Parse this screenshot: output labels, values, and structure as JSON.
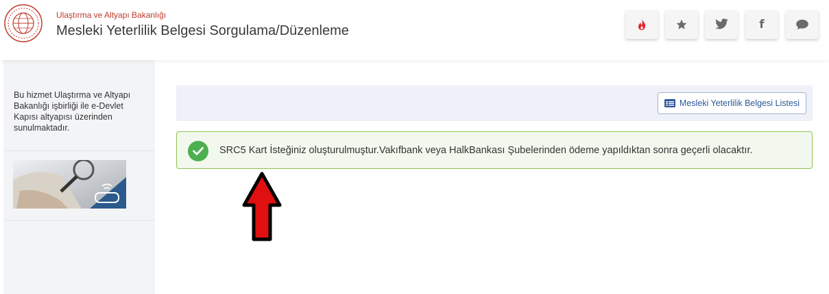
{
  "header": {
    "ministry": "Ulaştırma ve Altyapı Bakanlığı",
    "title": "Mesleki Yeterlilik Belgesi Sorgulama/Düzenleme",
    "buttons": [
      {
        "icon": "fire-icon"
      },
      {
        "icon": "star-icon"
      },
      {
        "icon": "twitter-icon"
      },
      {
        "icon": "facebook-icon",
        "glyph": "f"
      },
      {
        "icon": "comment-icon"
      }
    ]
  },
  "sidebar": {
    "info": "Bu hizmet Ulaştırma ve Altyapı Bakanlığı işbirliği ile e-Devlet Kapısı altyapısı üzerinden sunulmaktadır."
  },
  "toolbar": {
    "list_button": "Mesleki Yeterlilik Belgesi Listesi"
  },
  "alert": {
    "message": "SRC5 Kart İsteğiniz oluşturulmuştur.Vakıfbank veya HalkBankası Şubelerinden ödeme yapıldıktan sonra geçerli olacaktır."
  },
  "colors": {
    "ministry_red": "#c0392b",
    "success_green": "#4caf50",
    "alert_border": "#8bc34a",
    "link_blue": "#2b5797",
    "arrow_red": "#e01010"
  }
}
